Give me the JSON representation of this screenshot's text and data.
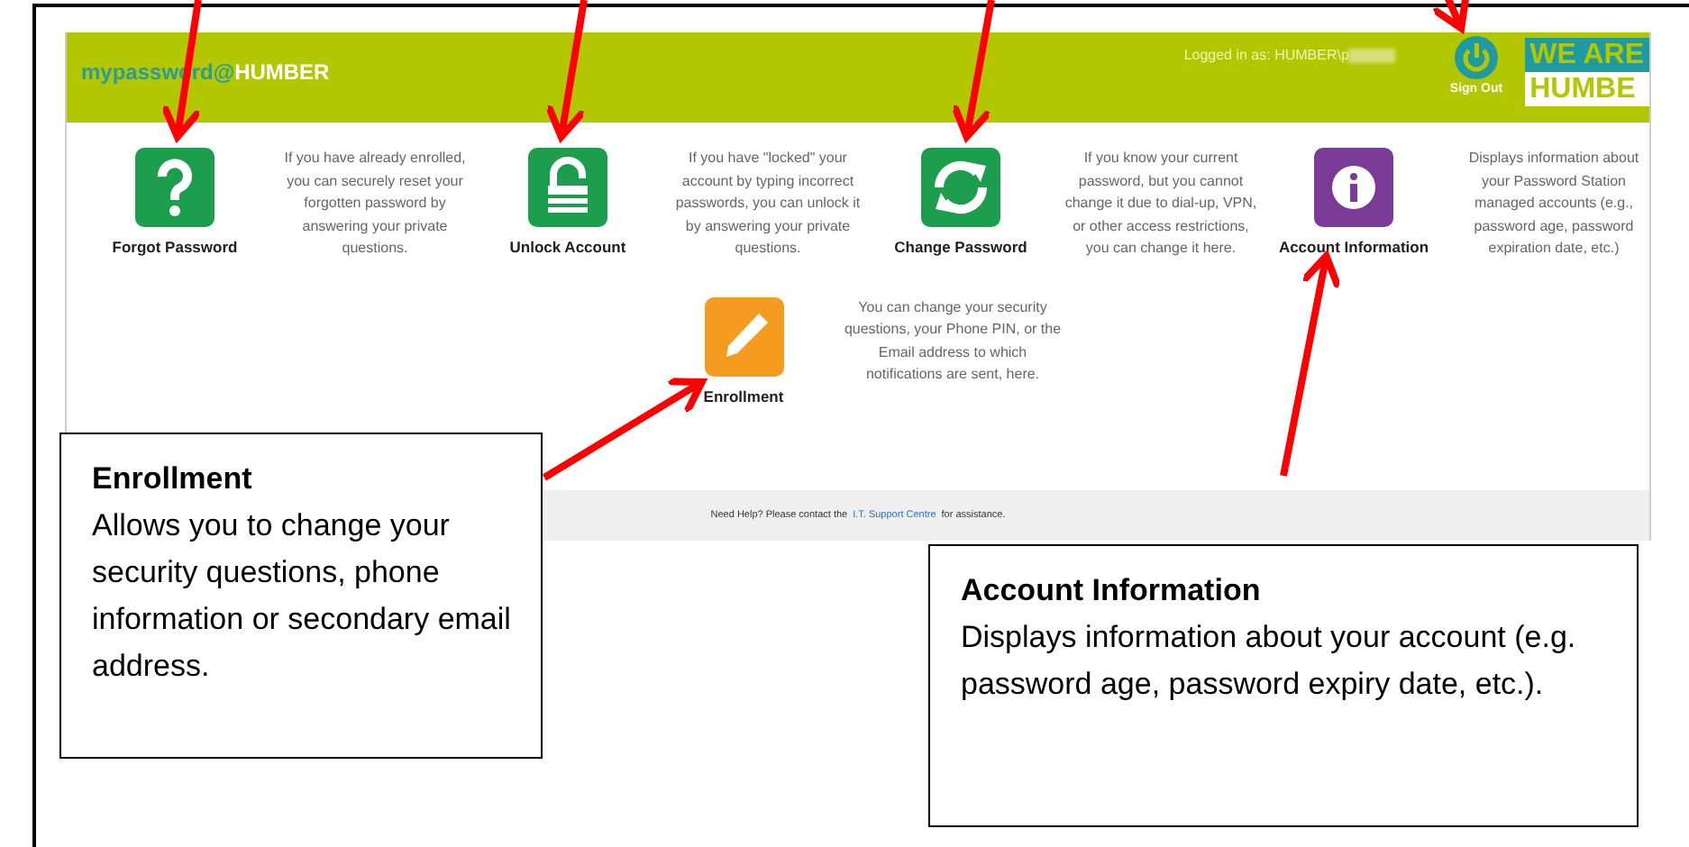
{
  "header": {
    "logo": {
      "prefix": "mypassword@",
      "suffix": "HUMBER"
    },
    "logged_in": "Logged in as: HUMBER\\p",
    "sign_out": "Sign Out",
    "brand": {
      "top": "WE ARE",
      "bottom": "HUMBE"
    }
  },
  "tiles": [
    {
      "kind": "question",
      "label": "Forgot Password",
      "description": "If you have already enrolled, you can securely reset your forgotten password by answering your private questions."
    },
    {
      "kind": "lock",
      "label": "Unlock Account",
      "description": "If you have \"locked\" your account by typing incorrect passwords, you can unlock it by answering your private questions."
    },
    {
      "kind": "refresh",
      "label": "Change Password",
      "description": "If you know your current password, but you cannot change it due to dial-up, VPN, or other access restrictions, you can change it here."
    },
    {
      "kind": "info",
      "label": "Account Information",
      "description": "Displays information about your Password Station managed accounts (e.g., password age, password expiration date, etc.)"
    },
    {
      "kind": "pencil",
      "label": "Enrollment",
      "description": "You can change your security questions, your Phone PIN, or the Email address to which notifications are sent, here."
    }
  ],
  "footer": {
    "before": "Need Help? Please contact the",
    "link": "I.T. Support Centre",
    "after": "for assistance."
  },
  "callouts": [
    {
      "title": "Enrollment",
      "body": "Allows you to change your security questions, phone information or secondary email address."
    },
    {
      "title": "Account Information",
      "body": "Displays information about your account (e.g. password age, password expiry date, etc.)."
    }
  ]
}
